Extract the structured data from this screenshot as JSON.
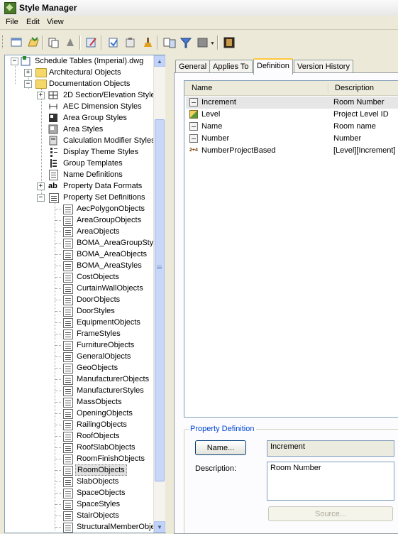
{
  "window": {
    "title": "Style Manager"
  },
  "menu": [
    "File",
    "Edit",
    "View"
  ],
  "tree": {
    "root": "Schedule Tables (Imperial).dwg",
    "architectural": "Architectural Objects",
    "documentation": "Documentation Objects",
    "doc_children": [
      "2D Section/Elevation Style",
      "AEC Dimension Styles",
      "Area Group Styles",
      "Area Styles",
      "Calculation Modifier Styles",
      "Display Theme Styles",
      "Group Templates",
      "Name Definitions",
      "Property Data Formats",
      "Property Set Definitions"
    ],
    "psd_children": [
      "AecPolygonObjects",
      "AreaGroupObjects",
      "AreaObjects",
      "BOMA_AreaGroupStyle",
      "BOMA_AreaObjects",
      "BOMA_AreaStyles",
      "CostObjects",
      "CurtainWallObjects",
      "DoorObjects",
      "DoorStyles",
      "EquipmentObjects",
      "FrameStyles",
      "FurnitureObjects",
      "GeneralObjects",
      "GeoObjects",
      "ManufacturerObjects",
      "ManufacturerStyles",
      "MassObjects",
      "OpeningObjects",
      "RailingObjects",
      "RoofObjects",
      "RoofSlabObjects",
      "RoomFinishObjects",
      "RoomObjects",
      "SlabObjects",
      "SpaceObjects",
      "SpaceStyles",
      "StairObjects",
      "StructuralMemberObje"
    ],
    "selected": "RoomObjects"
  },
  "tabs": [
    "General",
    "Applies To",
    "Definition",
    "Version History"
  ],
  "active_tab": "Definition",
  "list": {
    "columns": [
      "Name",
      "Description"
    ],
    "rows": [
      {
        "name": "Increment",
        "description": "Room Number",
        "icon": "property-icon"
      },
      {
        "name": "Level",
        "description": "Project Level ID",
        "icon": "auto-property-icon"
      },
      {
        "name": "Name",
        "description": "Room name",
        "icon": "property-icon"
      },
      {
        "name": "Number",
        "description": "Number",
        "icon": "property-icon"
      },
      {
        "name": "NumberProjectBased",
        "description": "[Level][Increment]",
        "icon": "formula-icon"
      }
    ]
  },
  "property_definition": {
    "group_label": "Property Definition",
    "name_button": "Name...",
    "name_value": "Increment",
    "description_label": "Description:",
    "description_value": "Room Number",
    "source_button": "Source..."
  }
}
